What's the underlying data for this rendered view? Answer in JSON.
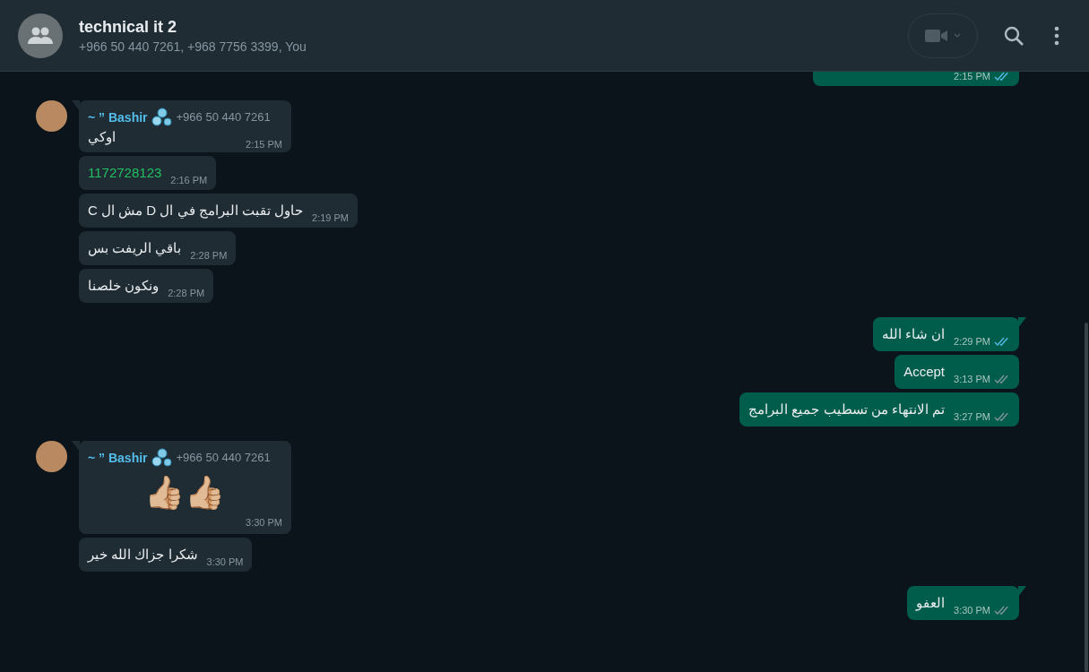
{
  "header": {
    "title": "technical it 2",
    "subtitle": "+966 50 440 7261, +968 7756 3399, You"
  },
  "messages": [
    {
      "outgoing": true,
      "kind": "text",
      "time": "2:15 PM",
      "read": true
    },
    {
      "outgoing": false,
      "kind": "text",
      "sender": {
        "name": "~ ” Bashir",
        "phone": "+966 50 440 7261"
      },
      "text": "اوكي",
      "time": "2:15 PM"
    },
    {
      "outgoing": false,
      "kind": "number",
      "text": "1172728123",
      "time": "2:16 PM"
    },
    {
      "outgoing": false,
      "kind": "text",
      "text": "حاول تقبت البرامج في ال D مش ال C",
      "time": "2:19 PM"
    },
    {
      "outgoing": false,
      "kind": "text",
      "text": "باقي الريفت بس",
      "time": "2:28 PM"
    },
    {
      "outgoing": false,
      "kind": "text",
      "text": "ونكون خلصنا",
      "time": "2:28 PM"
    },
    {
      "outgoing": true,
      "kind": "text",
      "text": "ان شاء الله",
      "time": "2:29 PM",
      "read": true
    },
    {
      "outgoing": true,
      "kind": "text",
      "text": "Accept",
      "time": "3:13 PM",
      "read": false
    },
    {
      "outgoing": true,
      "kind": "text",
      "text": "تم الانتهاء من تسطيب جميع البرامج",
      "time": "3:27 PM",
      "read": false
    },
    {
      "outgoing": false,
      "kind": "emoji",
      "sender": {
        "name": "~ ” Bashir",
        "phone": "+966 50 440 7261"
      },
      "text": "👍🏼👍🏼",
      "time": "3:30 PM"
    },
    {
      "outgoing": false,
      "kind": "text",
      "text": "شكرا جزاك الله خير",
      "time": "3:30 PM"
    },
    {
      "outgoing": true,
      "kind": "text",
      "text": "العفو",
      "time": "3:30 PM",
      "read": false
    }
  ]
}
